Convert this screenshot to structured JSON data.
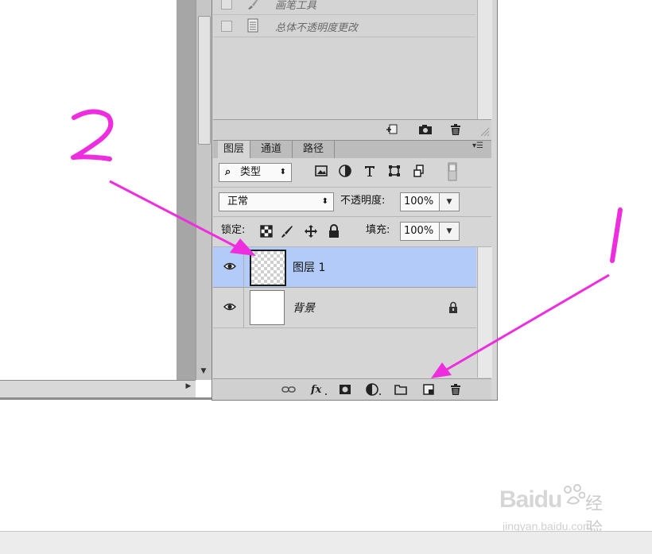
{
  "history_panel": {
    "items": [
      {
        "label": "画笔工具",
        "icon": "brush-icon",
        "enabled": false
      },
      {
        "label": "总体不透明度更改",
        "icon": "document-icon",
        "enabled": false
      }
    ],
    "footer_icons": [
      "new-document-from-state-icon",
      "snapshot-camera-icon",
      "trash-icon"
    ]
  },
  "layers_panel": {
    "tabs": [
      {
        "label": "图层",
        "active": true
      },
      {
        "label": "通道",
        "active": false
      },
      {
        "label": "路径",
        "active": false
      }
    ],
    "filter": {
      "kind_label": "类型",
      "icons": [
        "pixel-filter-icon",
        "adjustment-filter-icon",
        "type-filter-icon",
        "shape-filter-icon",
        "smart-object-filter-icon",
        "filter-toggle-icon"
      ]
    },
    "blend_mode": "正常",
    "opacity_label": "不透明度:",
    "opacity_value": "100%",
    "lock_label": "锁定:",
    "lock_icons": [
      "lock-transparent-pixels-icon",
      "lock-image-pixels-icon",
      "lock-position-icon",
      "lock-all-icon"
    ],
    "fill_label": "填充:",
    "fill_value": "100%",
    "layers": [
      {
        "name": "图层 1",
        "visible": true,
        "selected": true,
        "transparent": true,
        "locked": false
      },
      {
        "name": "背景",
        "visible": true,
        "selected": false,
        "transparent": false,
        "locked": true
      }
    ],
    "footer_icons": [
      "link-layers-icon",
      "fx-icon",
      "layer-mask-icon",
      "adjustment-layer-icon",
      "group-folder-icon",
      "new-layer-icon",
      "delete-layer-icon"
    ]
  },
  "annotations": {
    "label_1": "1",
    "label_2": "2",
    "color": "#ee2ddf"
  },
  "watermark": {
    "brand": "Baidu",
    "product": "经验",
    "url": "jingyan.baidu.com"
  }
}
